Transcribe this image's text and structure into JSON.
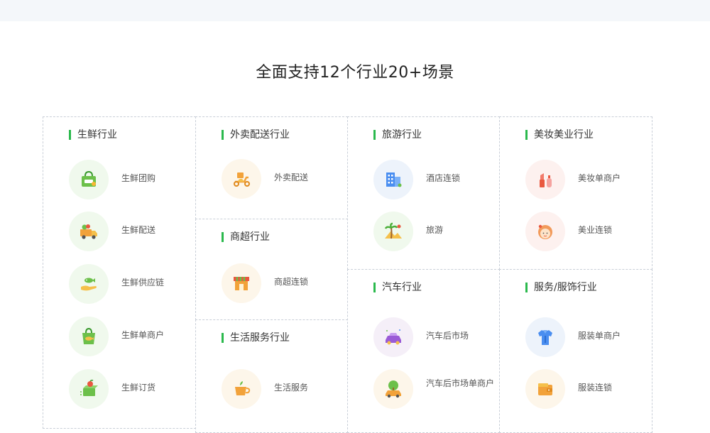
{
  "page": {
    "title": "全面支持12个行业20+场景"
  },
  "industries": {
    "fresh": {
      "title": "生鲜行业",
      "items": [
        {
          "label": "生鲜团购",
          "icon": "grocery-bag-icon"
        },
        {
          "label": "生鲜配送",
          "icon": "delivery-truck-icon"
        },
        {
          "label": "生鲜供应链",
          "icon": "hand-fish-icon"
        },
        {
          "label": "生鲜单商户",
          "icon": "shopping-bag-fish-icon"
        },
        {
          "label": "生鲜订货",
          "icon": "produce-box-icon"
        }
      ]
    },
    "takeout": {
      "title": "外卖配送行业",
      "items": [
        {
          "label": "外卖配送",
          "icon": "scooter-icon"
        }
      ]
    },
    "supermarket": {
      "title": "商超行业",
      "items": [
        {
          "label": "商超连锁",
          "icon": "storefront-icon"
        }
      ]
    },
    "life": {
      "title": "生活服务行业",
      "items": [
        {
          "label": "生活服务",
          "icon": "coffee-cup-icon"
        }
      ]
    },
    "travel": {
      "title": "旅游行业",
      "items": [
        {
          "label": "酒店连锁",
          "icon": "hotel-building-icon"
        },
        {
          "label": "旅游",
          "icon": "palm-tree-icon"
        }
      ]
    },
    "beauty": {
      "title": "美妆美业行业",
      "items": [
        {
          "label": "美妆单商户",
          "icon": "lipstick-icon"
        },
        {
          "label": "美业连锁",
          "icon": "woman-face-icon"
        }
      ]
    },
    "auto": {
      "title": "汽车行业",
      "items": [
        {
          "label": "汽车后市场",
          "icon": "sports-car-icon"
        },
        {
          "label": "汽车后市场单商户",
          "icon": "car-tree-icon"
        }
      ]
    },
    "service": {
      "title": "服务/服饰行业",
      "items": [
        {
          "label": "服装单商户",
          "icon": "shirt-icon"
        },
        {
          "label": "服装连锁",
          "icon": "wallet-icon"
        }
      ]
    }
  },
  "colors": {
    "accent": "#2bb94d",
    "border": "#c9cfd8",
    "topbar": "#f4f7fa"
  }
}
